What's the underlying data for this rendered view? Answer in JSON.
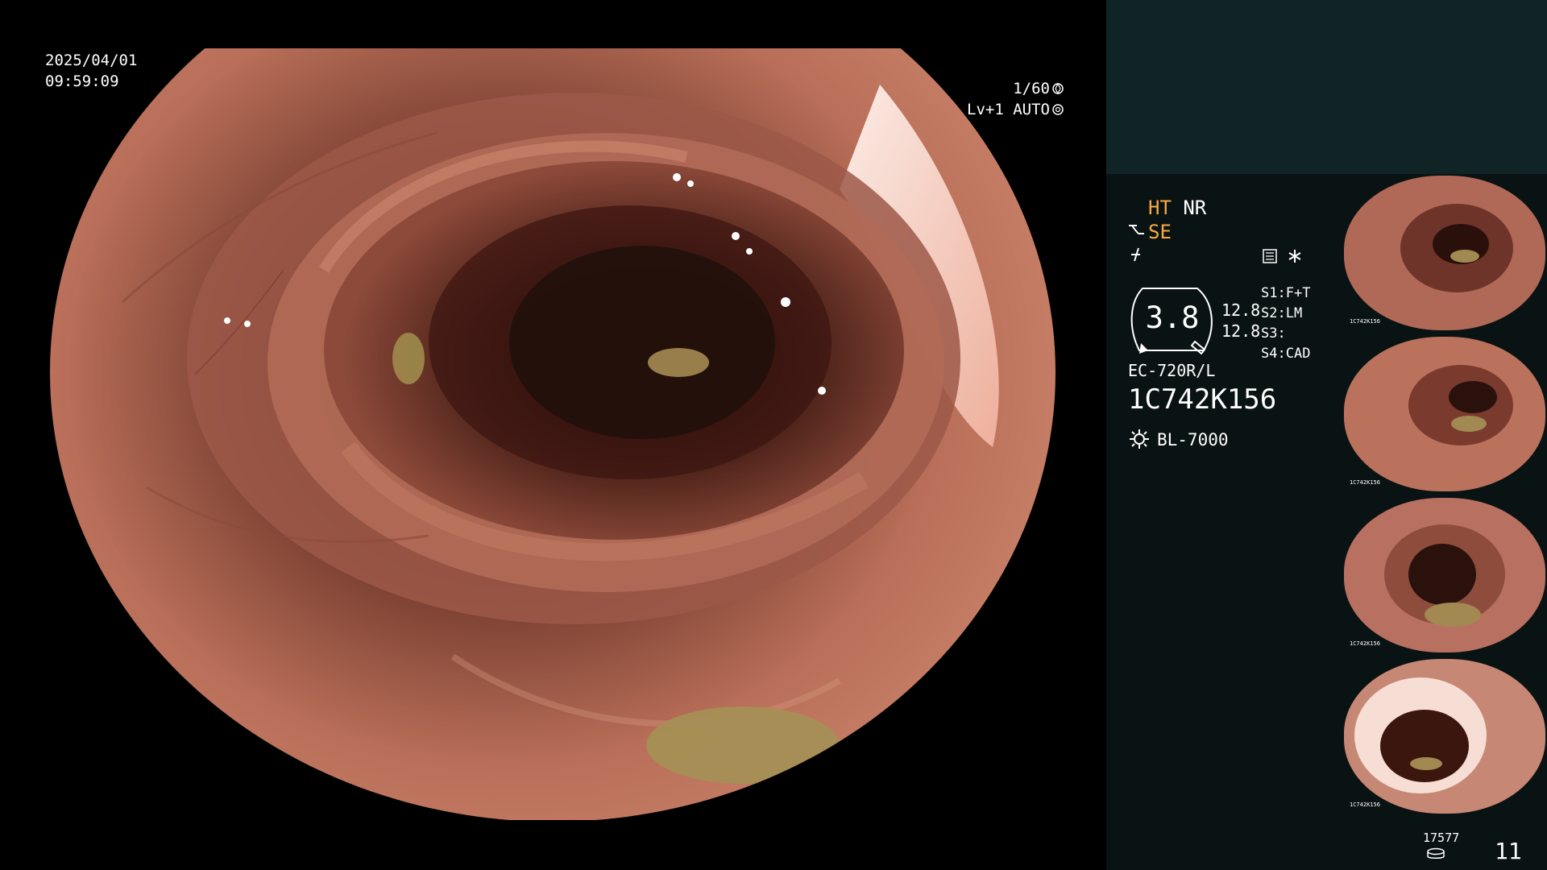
{
  "display": {
    "date": "2025/04/01",
    "time": "09:59:09",
    "exposure": "1/60",
    "level": "Lv+1 AUTO"
  },
  "panel": {
    "mode_orange": "HT",
    "mode_white": "NR",
    "se_label": "SE",
    "gauge_value": "3.8",
    "gauge_right_top": "12.8",
    "gauge_right_bottom": "12.8",
    "s1_label": "S1:",
    "s1_value": "F+T",
    "s2_label": "S2:",
    "s2_value": "LM",
    "s3_label": "S3:",
    "s3_value": "",
    "s4_label": "S4:",
    "s4_value": "CAD",
    "endoscope": "EC-720R/L",
    "serial": "1C742K156",
    "light_source": "BL-7000"
  },
  "thumbnails": [
    {
      "label": "1C742K156"
    },
    {
      "label": "1C742K156"
    },
    {
      "label": "1C742K156"
    },
    {
      "label": "1C742K156"
    }
  ],
  "footer": {
    "counter": "17577",
    "page": "11"
  }
}
